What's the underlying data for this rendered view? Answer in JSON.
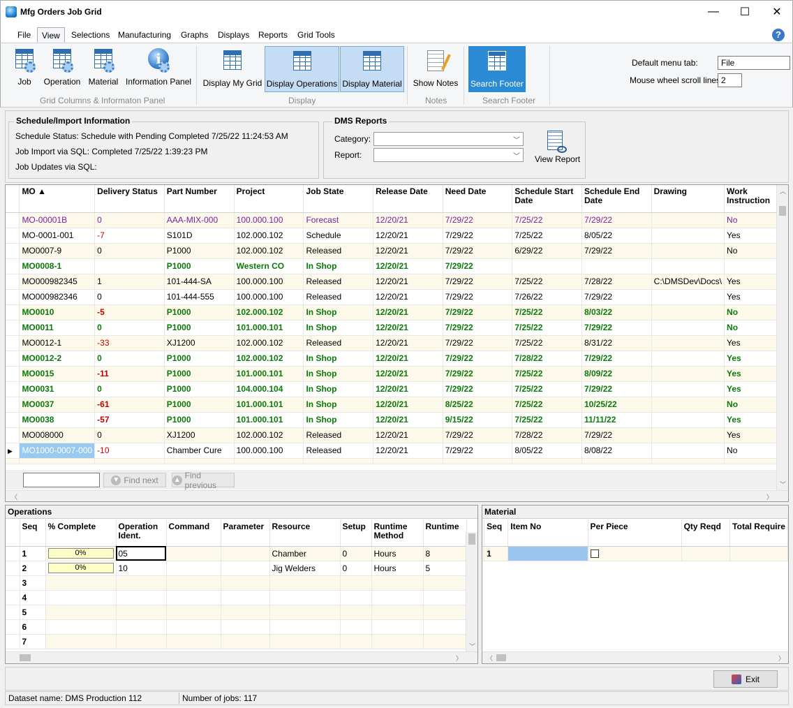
{
  "window": {
    "title": "Mfg Orders Job Grid",
    "minimize": "—",
    "maximize": "☐",
    "close": "✕"
  },
  "menu_tabs": [
    "File",
    "View",
    "Selections",
    "Manufacturing",
    "Graphs",
    "Displays",
    "Reports",
    "Grid Tools"
  ],
  "active_tab": "View",
  "ribbon": {
    "grid_columns": {
      "label": "Grid Columns & Informaton Panel",
      "buttons": [
        "Job",
        "Operation",
        "Material",
        "Information Panel"
      ]
    },
    "display": {
      "label": "Display",
      "buttons": [
        "Display My Grid",
        "Display Operations",
        "Display Material"
      ]
    },
    "notes": {
      "label": "Notes",
      "buttons": [
        "Show Notes"
      ]
    },
    "search_footer": {
      "label": "Search Footer",
      "buttons": [
        "Search Footer"
      ]
    },
    "default_menu_tab_label": "Default menu tab:",
    "default_menu_tab_value": "File",
    "mouse_wheel_label": "Mouse wheel scroll lines:",
    "mouse_wheel_value": "2"
  },
  "schedule_info": {
    "title": "Schedule/Import Information",
    "status": "Schedule Status:  Schedule with Pending Completed 7/25/22 11:24:53 AM",
    "import": "Job Import via SQL: Completed 7/25/22 1:39:23 PM",
    "updates": "Job Updates via SQL:"
  },
  "dms_reports": {
    "title": "DMS Reports",
    "category_label": "Category:",
    "report_label": "Report:",
    "category_value": "",
    "report_value": "",
    "view_report": "View Report"
  },
  "job_grid": {
    "columns": [
      "MO ▲",
      "Delivery Status",
      "Part Number",
      "Project",
      "Job State",
      "Release Date",
      "Need Date",
      "Schedule Start Date",
      "Schedule End Date",
      "Drawing",
      "Work Instruction"
    ],
    "rows": [
      {
        "style": "purple",
        "cells": [
          "MO-00001B",
          "0",
          "AAA-MIX-000",
          "100.000.100",
          "Forecast",
          "12/20/21",
          "7/29/22",
          "7/25/22",
          "7/29/22",
          "",
          "No"
        ]
      },
      {
        "style": "normal",
        "cells": [
          "MO-0001-001",
          "-7",
          "S101D",
          "102.000.102",
          "Schedule",
          "12/20/21",
          "7/29/22",
          "7/25/22",
          "8/05/22",
          "",
          "Yes"
        ]
      },
      {
        "style": "normal",
        "cells": [
          "MO0007-9",
          "0",
          "P1000",
          "102.000.102",
          "Released",
          "12/20/21",
          "7/29/22",
          "6/29/22",
          "7/29/22",
          "",
          "No"
        ]
      },
      {
        "style": "green",
        "cells": [
          "MO0008-1",
          "",
          "P1000",
          "Western CO",
          "In Shop",
          "12/20/21",
          "7/29/22",
          "",
          "",
          "",
          ""
        ]
      },
      {
        "style": "normal",
        "cells": [
          "MO000982345",
          "1",
          "101-444-SA",
          "100.000.100",
          "Released",
          "12/20/21",
          "7/29/22",
          "7/25/22",
          "7/28/22",
          "C:\\DMSDev\\Docs\\",
          "Yes"
        ]
      },
      {
        "style": "normal",
        "cells": [
          "MO000982346",
          "0",
          "101-444-555",
          "100.000.100",
          "Released",
          "12/20/21",
          "7/29/22",
          "7/26/22",
          "7/29/22",
          "",
          "Yes"
        ]
      },
      {
        "style": "green",
        "cells": [
          "MO0010",
          "-5",
          "P1000",
          "102.000.102",
          "In Shop",
          "12/20/21",
          "7/29/22",
          "7/25/22",
          "8/03/22",
          "",
          "No"
        ]
      },
      {
        "style": "green",
        "cells": [
          "MO0011",
          "0",
          "P1000",
          "101.000.101",
          "In Shop",
          "12/20/21",
          "7/29/22",
          "7/25/22",
          "7/29/22",
          "",
          "No"
        ]
      },
      {
        "style": "normal",
        "cells": [
          "MO0012-1",
          "-33",
          "XJ1200",
          "102.000.102",
          "Released",
          "12/20/21",
          "7/29/22",
          "7/25/22",
          "8/31/22",
          "",
          "Yes"
        ]
      },
      {
        "style": "green",
        "cells": [
          "MO0012-2",
          "0",
          "P1000",
          "102.000.102",
          "In Shop",
          "12/20/21",
          "7/29/22",
          "7/28/22",
          "7/29/22",
          "",
          "Yes"
        ]
      },
      {
        "style": "green",
        "cells": [
          "MO0015",
          "-11",
          "P1000",
          "101.000.101",
          "In Shop",
          "12/20/21",
          "7/29/22",
          "7/25/22",
          "8/09/22",
          "",
          "Yes"
        ]
      },
      {
        "style": "green",
        "cells": [
          "MO0031",
          "0",
          "P1000",
          "104.000.104",
          "In Shop",
          "12/20/21",
          "7/29/22",
          "7/25/22",
          "7/29/22",
          "",
          "Yes"
        ]
      },
      {
        "style": "green",
        "cells": [
          "MO0037",
          "-61",
          "P1000",
          "101.000.101",
          "In Shop",
          "12/20/21",
          "8/25/22",
          "7/25/22",
          "10/25/22",
          "",
          "No"
        ]
      },
      {
        "style": "green",
        "cells": [
          "MO0038",
          "-57",
          "P1000",
          "101.000.101",
          "In Shop",
          "12/20/21",
          "9/15/22",
          "7/25/22",
          "11/11/22",
          "",
          "Yes"
        ]
      },
      {
        "style": "normal",
        "cells": [
          "MO008000",
          "0",
          "XJ1200",
          "102.000.102",
          "Released",
          "12/20/21",
          "7/29/22",
          "7/28/22",
          "7/29/22",
          "",
          "Yes"
        ]
      },
      {
        "style": "normal",
        "cells": [
          "MO1000-0007-000",
          "-10",
          "Chamber Cure",
          "100.000.100",
          "Released",
          "12/20/21",
          "7/29/22",
          "8/05/22",
          "8/08/22",
          "",
          "No"
        ]
      }
    ],
    "selected_row": 15,
    "find_next": "Find next",
    "find_previous": "Find previous",
    "search_value": ""
  },
  "operations": {
    "title": "Operations",
    "columns": [
      "Seq",
      "% Complete",
      "Operation Ident.",
      "Command",
      "Parameter",
      "Resource",
      "Setup",
      "Runtime Method",
      "Runtime"
    ],
    "rows": [
      {
        "seq": "1",
        "pct": "0%",
        "ident": "05",
        "command": "",
        "parameter": "",
        "resource": "Chamber",
        "setup": "0",
        "method": "Hours",
        "runtime": "8"
      },
      {
        "seq": "2",
        "pct": "0%",
        "ident": "10",
        "command": "",
        "parameter": "",
        "resource": "Jig Welders",
        "setup": "0",
        "method": "Hours",
        "runtime": "5"
      },
      {
        "seq": "3"
      },
      {
        "seq": "4"
      },
      {
        "seq": "5"
      },
      {
        "seq": "6"
      },
      {
        "seq": "7"
      }
    ]
  },
  "material": {
    "title": "Material",
    "columns": [
      "Seq",
      "Item No",
      "Per Piece",
      "Qty Reqd",
      "Total Require"
    ],
    "rows": [
      {
        "seq": "1",
        "item": "",
        "per_piece": "",
        "qty": "",
        "total": ""
      }
    ]
  },
  "footer": {
    "exit": "Exit",
    "dataset": "Dataset name:  DMS Production 112",
    "jobs": "Number of jobs: 117"
  },
  "colors": {
    "accent": "#2a8ad4",
    "green_state": "#0a7a0a",
    "purple_state": "#7a1fa2",
    "negative": "#c00000",
    "row_alt": "#fdf9ea"
  }
}
